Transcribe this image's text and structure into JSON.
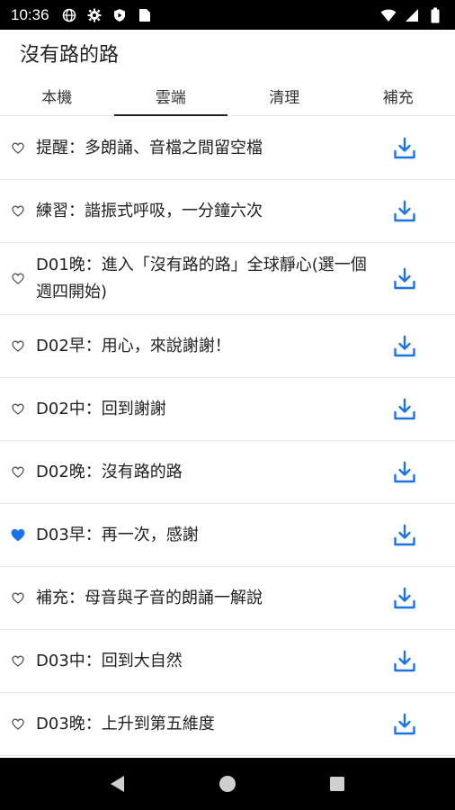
{
  "status_bar": {
    "time": "10:36",
    "icons_left": [
      "globe-icon",
      "gear-icon",
      "shield-play-icon",
      "sim-card-icon"
    ],
    "icons_right": [
      "wifi-icon",
      "signal-icon",
      "battery-icon"
    ]
  },
  "app": {
    "title": "沒有路的路"
  },
  "tabs": [
    {
      "label": "本機",
      "active": false
    },
    {
      "label": "雲端",
      "active": true
    },
    {
      "label": "清理",
      "active": false
    },
    {
      "label": "補充",
      "active": false
    }
  ],
  "items": [
    {
      "text": "提醒：多朗誦、音檔之間留空檔",
      "favorite": false
    },
    {
      "text": "練習：諧振式呼吸，一分鐘六次",
      "favorite": false
    },
    {
      "text": "D01晚：進入「沒有路的路」全球靜心(選一個週四開始)",
      "favorite": false
    },
    {
      "text": "D02早：用心，來說謝謝！",
      "favorite": false
    },
    {
      "text": "D02中：回到謝謝",
      "favorite": false
    },
    {
      "text": "D02晚：沒有路的路",
      "favorite": false
    },
    {
      "text": "D03早：再一次，感謝",
      "favorite": true
    },
    {
      "text": "補充：母音與子音的朗誦一解說",
      "favorite": false
    },
    {
      "text": "D03中：回到大自然",
      "favorite": false
    },
    {
      "text": "D03晚：上升到第五維度",
      "favorite": false
    }
  ],
  "colors": {
    "accent": "#1a73e8",
    "heart_filled": "#1a73e8",
    "heart_outline": "#555555",
    "divider": "#e6e6e6",
    "text": "#222222"
  },
  "nav": {
    "buttons": [
      "back-icon",
      "home-icon",
      "recents-icon"
    ]
  }
}
